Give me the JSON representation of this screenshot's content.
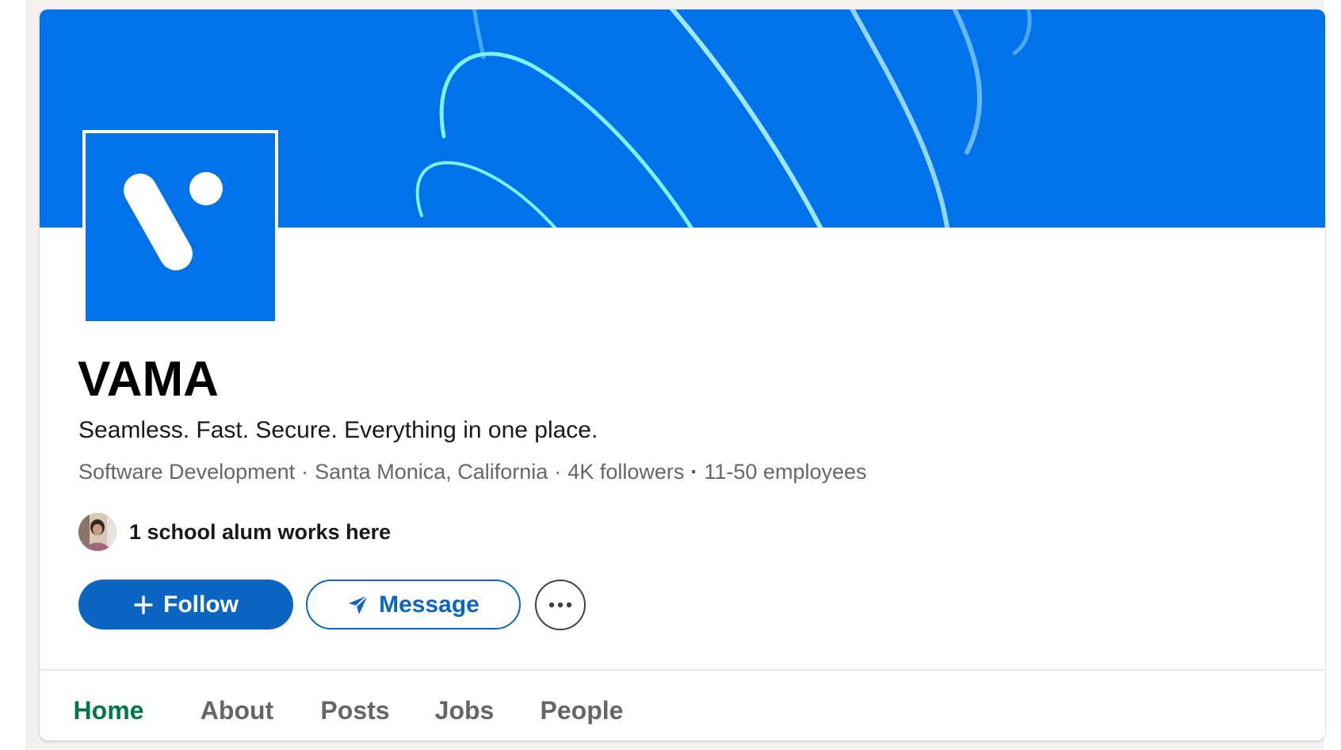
{
  "colors": {
    "banner": "#0073ea",
    "brand_blue": "#0a66c2",
    "active_tab": "#01754f",
    "muted_text": "#666666"
  },
  "company": {
    "name": "VAMA",
    "tagline": "Seamless. Fast. Secure. Everything in one place.",
    "industry": "Software Development",
    "location": "Santa Monica, California",
    "followers": "4K followers",
    "employees": "11-50 employees",
    "logo_icon": "vama-logo"
  },
  "alumni": {
    "text": "1 school alum works here",
    "avatar_icon": "person-avatar"
  },
  "actions": {
    "follow_label": "Follow",
    "follow_icon": "plus-icon",
    "message_label": "Message",
    "message_icon": "paper-plane-icon",
    "more_icon": "ellipsis-icon"
  },
  "tabs": [
    {
      "label": "Home",
      "active": true
    },
    {
      "label": "About",
      "active": false
    },
    {
      "label": "Posts",
      "active": false
    },
    {
      "label": "Jobs",
      "active": false
    },
    {
      "label": "People",
      "active": false
    }
  ]
}
